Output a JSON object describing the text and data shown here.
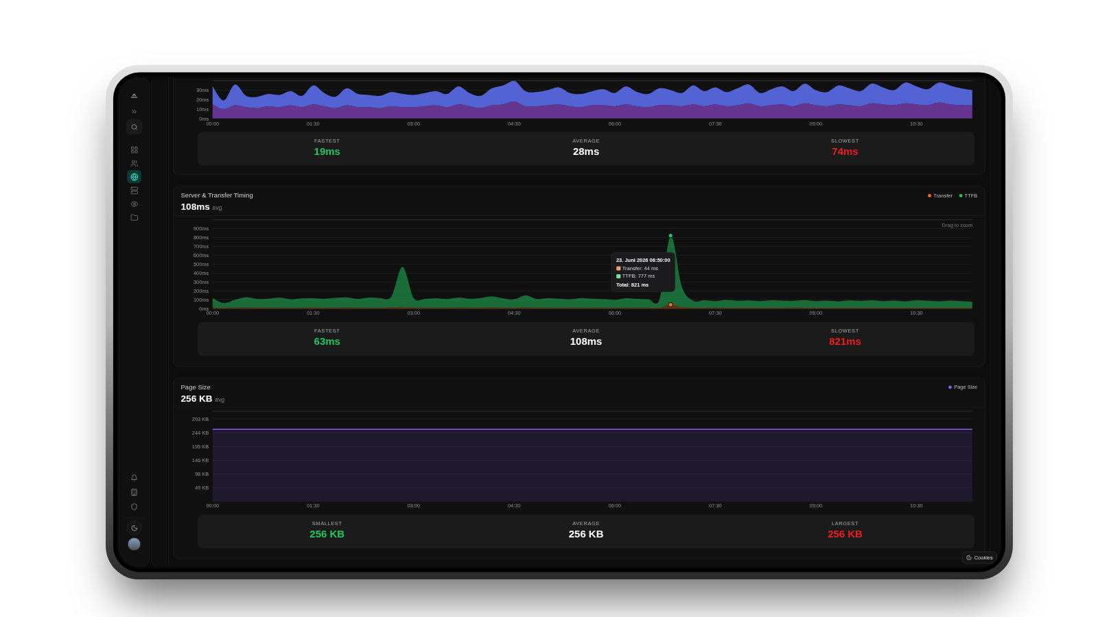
{
  "sidebar": {
    "nav": [
      {
        "selected": false
      },
      {
        "selected": false
      },
      {
        "selected": true
      },
      {
        "selected": false
      },
      {
        "selected": false
      },
      {
        "selected": false
      }
    ]
  },
  "cards": [
    {
      "chart_data": {
        "type": "area",
        "stacked": true,
        "grid": true,
        "x": [
          0,
          10,
          20,
          30,
          40,
          50,
          60,
          70,
          80,
          90,
          100,
          110,
          120,
          130,
          140,
          150,
          160,
          170,
          180,
          190,
          200,
          210,
          220,
          230,
          240,
          250,
          260,
          270,
          280,
          290,
          300,
          310,
          320,
          330,
          340,
          350,
          360,
          370,
          380,
          390,
          400,
          410,
          420,
          430,
          440,
          450,
          460,
          470,
          480,
          490,
          500,
          510,
          520,
          530,
          540,
          550,
          560,
          570,
          580,
          590,
          600,
          610,
          620,
          630,
          640,
          650,
          660,
          670,
          680
        ],
        "xlim": [
          0,
          680
        ],
        "ylim": [
          0,
          40
        ],
        "xticks": [
          {
            "value": 0,
            "label": "00:00"
          },
          {
            "value": 90,
            "label": "01:30"
          },
          {
            "value": 180,
            "label": "03:00"
          },
          {
            "value": 270,
            "label": "04:30"
          },
          {
            "value": 360,
            "label": "06:00"
          },
          {
            "value": 450,
            "label": "07:30"
          },
          {
            "value": 540,
            "label": "09:00"
          },
          {
            "value": 630,
            "label": "10:30"
          }
        ],
        "yticks": [
          {
            "value": 0,
            "label": "0ms"
          },
          {
            "value": 10,
            "label": "10ms"
          },
          {
            "value": 20,
            "label": "20ms"
          },
          {
            "value": 30,
            "label": "30ms"
          }
        ],
        "series": [
          {
            "color": "#66358f",
            "values": [
              15,
              10,
              14,
              12,
              11,
              13,
              12,
              14,
              12,
              15,
              13,
              11,
              14,
              12,
              12,
              11,
              13,
              12,
              12,
              13,
              14,
              12,
              15,
              13,
              11,
              14,
              15,
              18,
              13,
              13,
              14,
              15,
              13,
              12,
              14,
              14,
              13,
              15,
              13,
              12,
              14,
              14,
              13,
              15,
              13,
              15,
              13,
              14,
              16,
              13,
              14,
              15,
              13,
              16,
              14,
              13,
              15,
              14,
              13,
              16,
              15,
              14,
              16,
              15,
              14,
              17,
              15,
              14,
              14
            ]
          },
          {
            "color": "#5363d3",
            "values": [
              19,
              9,
              22,
              12,
              12,
              13,
              13,
              15,
              12,
              20,
              14,
              12,
              18,
              14,
              13,
              13,
              15,
              14,
              13,
              14,
              15,
              14,
              19,
              14,
              13,
              18,
              20,
              22,
              16,
              15,
              16,
              18,
              14,
              14,
              15,
              17,
              14,
              19,
              15,
              14,
              18,
              16,
              14,
              20,
              16,
              18,
              15,
              18,
              20,
              14,
              17,
              19,
              16,
              21,
              16,
              15,
              20,
              18,
              16,
              21,
              18,
              16,
              22,
              19,
              17,
              21,
              20,
              18,
              16
            ]
          }
        ]
      },
      "stats": [
        {
          "label": "FASTEST",
          "value": "19ms",
          "color": "#22c55e"
        },
        {
          "label": "AVERAGE",
          "value": "28ms",
          "color": "#ffffff"
        },
        {
          "label": "SLOWEST",
          "value": "74ms",
          "color": "#ef1d1d"
        }
      ]
    },
    {
      "title": "Server & Transfer Timing",
      "value": "108ms",
      "suffix": "avg",
      "hint": "Drag to zoom",
      "chart_data": {
        "type": "area",
        "stacked": true,
        "grid": true,
        "x": [
          0,
          10,
          20,
          30,
          40,
          50,
          60,
          70,
          80,
          90,
          100,
          110,
          120,
          130,
          140,
          150,
          160,
          170,
          180,
          190,
          200,
          210,
          220,
          230,
          240,
          250,
          260,
          270,
          280,
          290,
          300,
          310,
          320,
          330,
          340,
          350,
          360,
          370,
          380,
          390,
          400,
          410,
          420,
          430,
          440,
          450,
          460,
          470,
          480,
          490,
          500,
          510,
          520,
          530,
          540,
          550,
          560,
          570,
          580,
          590,
          600,
          610,
          620,
          630,
          640,
          650,
          660,
          670,
          680
        ],
        "xlim": [
          0,
          680
        ],
        "ylim": [
          0,
          1000
        ],
        "xticks": [
          {
            "value": 0,
            "label": "00:00"
          },
          {
            "value": 90,
            "label": "01:30"
          },
          {
            "value": 180,
            "label": "03:00"
          },
          {
            "value": 270,
            "label": "04:30"
          },
          {
            "value": 360,
            "label": "06:00"
          },
          {
            "value": 450,
            "label": "07:30"
          },
          {
            "value": 540,
            "label": "09:00"
          },
          {
            "value": 630,
            "label": "10:30"
          }
        ],
        "yticks": [
          {
            "value": 0,
            "label": "0ms"
          },
          {
            "value": 100,
            "label": "100ms"
          },
          {
            "value": 200,
            "label": "200ms"
          },
          {
            "value": 300,
            "label": "300ms"
          },
          {
            "value": 400,
            "label": "400ms"
          },
          {
            "value": 500,
            "label": "500ms"
          },
          {
            "value": 600,
            "label": "600ms"
          },
          {
            "value": 700,
            "label": "700ms"
          },
          {
            "value": 800,
            "label": "800ms"
          },
          {
            "value": 900,
            "label": "900ms"
          }
        ],
        "series": [
          {
            "name": "Transfer",
            "color": "#f97316",
            "values": [
              12,
              10,
              11,
              13,
              12,
              11,
              12,
              11,
              12,
              13,
              11,
              12,
              13,
              11,
              12,
              12,
              13,
              20,
              12,
              11,
              12,
              11,
              13,
              12,
              12,
              13,
              12,
              11,
              14,
              12,
              12,
              11,
              11,
              12,
              12,
              11,
              11,
              12,
              11,
              11,
              10,
              44,
              18,
              10,
              10,
              11,
              10,
              10,
              10,
              10,
              10,
              10,
              11,
              10,
              10,
              9,
              10,
              10,
              10,
              10,
              9,
              10,
              9,
              10,
              10,
              9,
              10,
              10,
              9
            ]
          },
          {
            "name": "TTFB",
            "color": "#22c55e",
            "values": [
              108,
              53,
              89,
              117,
              98,
              101,
              113,
              94,
              103,
              105,
              101,
              110,
              115,
              99,
              113,
              108,
              122,
              450,
              108,
              99,
              106,
              97,
              112,
              100,
              108,
              125,
              103,
              94,
              136,
              98,
              106,
              101,
              94,
              108,
              100,
              97,
              89,
              106,
              99,
              94,
              90,
              777,
              232,
              80,
              85,
              74,
              88,
              78,
              82,
              75,
              85,
              80,
              77,
              86,
              75,
              81,
              74,
              82,
              78,
              85,
              77,
              80,
              73,
              85,
              78,
              75,
              80,
              76,
              71
            ]
          }
        ]
      },
      "tooltip": {
        "title": "23. Juni 2026 06:50:00",
        "rows": [
          {
            "label": "Transfer: 44 ms",
            "color": "#f4a26a"
          },
          {
            "label": "TTFB: 777 ms",
            "color": "#7ddf9b"
          }
        ],
        "total": "Total: 821 ms"
      },
      "stats": [
        {
          "label": "FASTEST",
          "value": "63ms",
          "color": "#22c55e"
        },
        {
          "label": "AVERAGE",
          "value": "108ms",
          "color": "#ffffff"
        },
        {
          "label": "SLOWEST",
          "value": "821ms",
          "color": "#ef1d1d"
        }
      ]
    },
    {
      "title": "Page Size",
      "value": "256 KB",
      "suffix": "avg",
      "chart_data": {
        "type": "area",
        "grid": true,
        "x": [
          0,
          680
        ],
        "xlim": [
          0,
          680
        ],
        "ylim": [
          0,
          320
        ],
        "xticks": [
          {
            "value": 0,
            "label": "00:00"
          },
          {
            "value": 90,
            "label": "01:30"
          },
          {
            "value": 180,
            "label": "03:00"
          },
          {
            "value": 270,
            "label": "04:30"
          },
          {
            "value": 360,
            "label": "06:00"
          },
          {
            "value": 450,
            "label": "07:30"
          },
          {
            "value": 540,
            "label": "09:00"
          },
          {
            "value": 630,
            "label": "10:30"
          }
        ],
        "yticks": [
          {
            "value": 49,
            "label": "49 KB"
          },
          {
            "value": 98,
            "label": "98 KB"
          },
          {
            "value": 146,
            "label": "146 KB"
          },
          {
            "value": 195,
            "label": "195 KB"
          },
          {
            "value": 244,
            "label": "244 KB"
          },
          {
            "value": 293,
            "label": "293 KB"
          }
        ],
        "series": [
          {
            "name": "Page Size",
            "color": "#8b5cf6",
            "values": [
              256,
              256
            ]
          }
        ]
      },
      "stats": [
        {
          "label": "SMALLEST",
          "value": "256 KB",
          "color": "#22c55e"
        },
        {
          "label": "AVERAGE",
          "value": "256 KB",
          "color": "#ffffff"
        },
        {
          "label": "LARGEST",
          "value": "256 KB",
          "color": "#ef1d1d"
        }
      ]
    }
  ],
  "cookies_button": {
    "label": "Cookies"
  }
}
